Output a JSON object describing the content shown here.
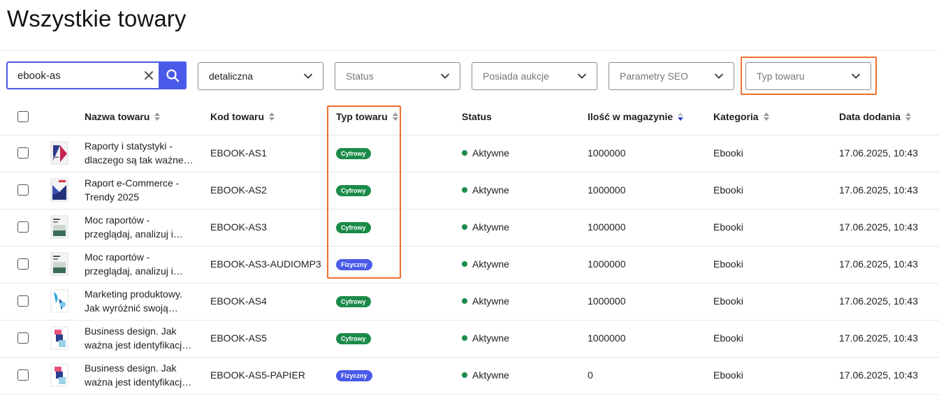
{
  "page": {
    "title": "Wszystkie towary"
  },
  "filters": {
    "search": {
      "value": "ebook-as",
      "placeholder": ""
    },
    "price_type": {
      "value": "detaliczna"
    },
    "status": {
      "placeholder": "Status"
    },
    "auctions": {
      "placeholder": "Posiada aukcje"
    },
    "seo": {
      "placeholder": "Parametry SEO"
    },
    "product_type": {
      "placeholder": "Typ towaru"
    }
  },
  "table": {
    "columns": {
      "name": "Nazwa towaru",
      "code": "Kod towaru",
      "type": "Typ towaru",
      "status": "Status",
      "stock": "Ilość w magazynie",
      "category": "Kategoria",
      "date": "Data dodania"
    },
    "rows": [
      {
        "name": "Raporty i statystyki - dlaczego są tak ważne dla biznesu",
        "code": "EBOOK-AS1",
        "type": "Cyfrowy",
        "status": "Aktywne",
        "stock": "1000000",
        "category": "Ebooki",
        "date": "17.06.2025, 10:43"
      },
      {
        "name": "Raport e-Commerce - Trendy 2025",
        "code": "EBOOK-AS2",
        "type": "Cyfrowy",
        "status": "Aktywne",
        "stock": "1000000",
        "category": "Ebooki",
        "date": "17.06.2025, 10:43"
      },
      {
        "name": "Moc raportów - przeglądaj, analizuj i działaj",
        "code": "EBOOK-AS3",
        "type": "Cyfrowy",
        "status": "Aktywne",
        "stock": "1000000",
        "category": "Ebooki",
        "date": "17.06.2025, 10:43"
      },
      {
        "name": "Moc raportów - przeglądaj, analizuj i działaj",
        "code": "EBOOK-AS3-AUDIOMP3",
        "type": "Fizyczny",
        "status": "Aktywne",
        "stock": "1000000",
        "category": "Ebooki",
        "date": "17.06.2025, 10:43"
      },
      {
        "name": "Marketing produktowy. Jak wyróżnić swoją markę",
        "code": "EBOOK-AS4",
        "type": "Cyfrowy",
        "status": "Aktywne",
        "stock": "1000000",
        "category": "Ebooki",
        "date": "17.06.2025, 10:43"
      },
      {
        "name": "Business design. Jak ważna jest identyfikacja wizualna",
        "code": "EBOOK-AS5",
        "type": "Cyfrowy",
        "status": "Aktywne",
        "stock": "1000000",
        "category": "Ebooki",
        "date": "17.06.2025, 10:43"
      },
      {
        "name": "Business design. Jak ważna jest identyfikacja wizualna",
        "code": "EBOOK-AS5-PAPIER",
        "type": "Fizyczny",
        "status": "Aktywne",
        "stock": "0",
        "category": "Ebooki",
        "date": "17.06.2025, 10:43"
      }
    ]
  },
  "colors": {
    "accent": "#4a5ae8",
    "highlight": "#ef6f2e",
    "digital_badge": "#1c8b4a",
    "physical_badge": "#4a5ae8",
    "status_active": "#1c8b4a"
  },
  "icons": [
    "clear-icon",
    "search-icon",
    "chevron-down-icon",
    "sort-icon",
    "book-cover-icon"
  ]
}
